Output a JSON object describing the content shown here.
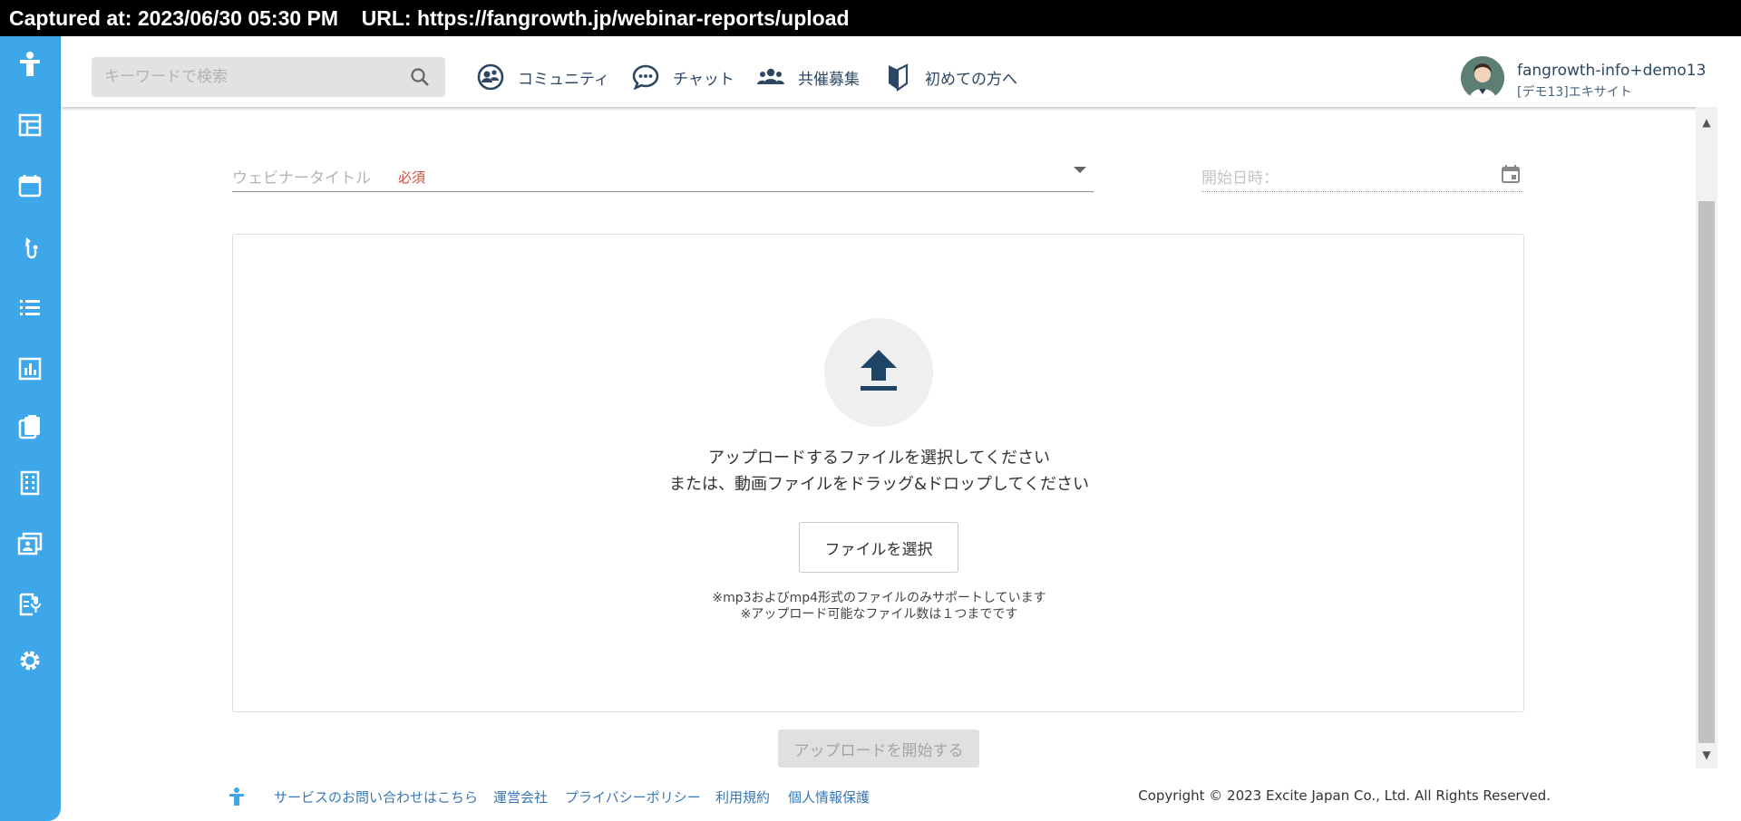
{
  "capture": {
    "text": "Captured at: 2023/06/30 05:30 PM    URL: https://fangrowth.jp/webinar-reports/upload"
  },
  "colors": {
    "sidebar_bg": "#3ea7ea",
    "nav_text": "#2d4763",
    "required": "#d44a3a",
    "link": "#3a77b5",
    "upload_icon": "#1e4466"
  },
  "sidebar": {
    "items": [
      {
        "icon": "logo-person-icon"
      },
      {
        "icon": "dashboard-icon"
      },
      {
        "icon": "calendar-icon"
      },
      {
        "icon": "microphone-icon"
      },
      {
        "icon": "list-icon"
      },
      {
        "icon": "bar-chart-icon"
      },
      {
        "icon": "clipboard-icon"
      },
      {
        "icon": "building-icon"
      },
      {
        "icon": "contact-card-icon"
      },
      {
        "icon": "report-mic-icon"
      },
      {
        "icon": "gear-icon"
      }
    ]
  },
  "header": {
    "search": {
      "placeholder": "キーワードで検索"
    },
    "nav": [
      {
        "label": "コミュニティ",
        "icon": "community-icon"
      },
      {
        "label": "チャット",
        "icon": "chat-icon"
      },
      {
        "label": "共催募集",
        "icon": "group-icon"
      },
      {
        "label": "初めての方へ",
        "icon": "beginner-mark-icon"
      }
    ],
    "user": {
      "name": "fangrowth-info+demo13",
      "org": "[デモ13]エキサイト"
    }
  },
  "form": {
    "title_label": "ウェビナータイトル",
    "required_label": "必須",
    "date_label": "開始日時："
  },
  "upload": {
    "line1": "アップロードするファイルを選択してください",
    "line2": "または、動画ファイルをドラッグ&ドロップしてください",
    "select_button": "ファイルを選択",
    "note1": "※mp3およびmp4形式のファイルのみサポートしています",
    "note2": "※アップロード可能なファイル数は１つまでです",
    "start_button": "アップロードを開始する"
  },
  "footer": {
    "links": [
      "サービスのお問い合わせはこちら",
      "運営会社",
      "プライバシーポリシー",
      "利用規約",
      "個人情報保護"
    ],
    "copyright": "Copyright © 2023 Excite Japan Co., Ltd. All Rights Reserved."
  }
}
